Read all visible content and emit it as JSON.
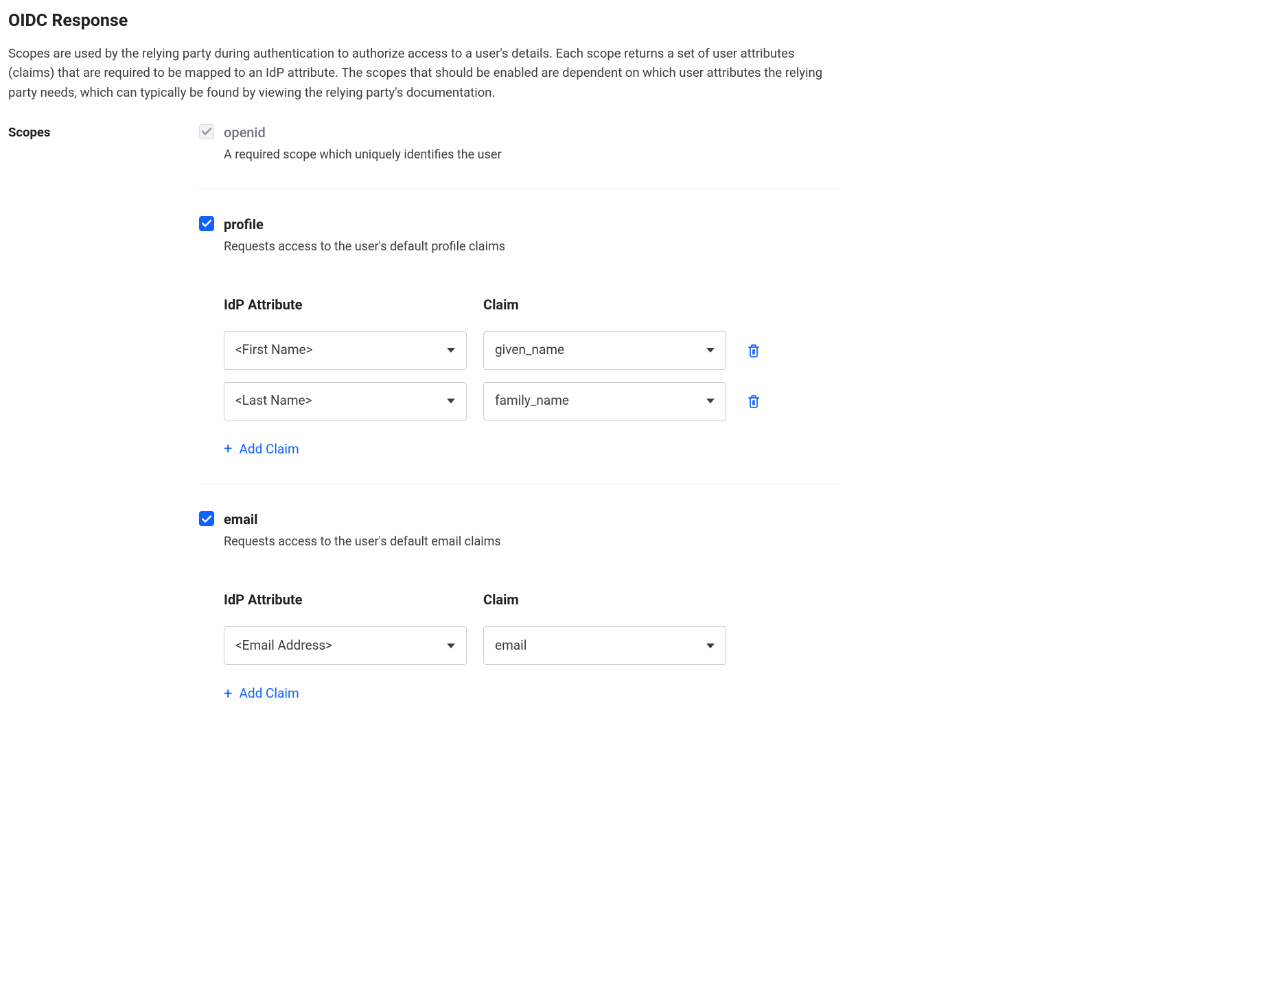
{
  "header": {
    "title": "OIDC Response",
    "intro": "Scopes are used by the relying party during authentication to authorize access to a user's details. Each scope returns a set of user attributes (claims) that are required to be mapped to an IdP attribute. The scopes that should be enabled are dependent on which user attributes the relying party needs, which can typically be found by viewing the relying party's documentation."
  },
  "labels": {
    "scopes": "Scopes",
    "idp_attribute": "IdP Attribute",
    "claim": "Claim",
    "add_claim": "Add Claim"
  },
  "scopes": {
    "openid": {
      "name": "openid",
      "desc": "A required scope which uniquely identifies the user",
      "checked": true,
      "disabled": true
    },
    "profile": {
      "name": "profile",
      "desc": "Requests access to the user's default profile claims",
      "checked": true,
      "disabled": false,
      "claims": [
        {
          "idp": "<First Name>",
          "claim": "given_name",
          "deletable": true
        },
        {
          "idp": "<Last Name>",
          "claim": "family_name",
          "deletable": true
        }
      ]
    },
    "email": {
      "name": "email",
      "desc": "Requests access to the user's default email claims",
      "checked": true,
      "disabled": false,
      "claims": [
        {
          "idp": "<Email Address>",
          "claim": "email",
          "deletable": false
        }
      ]
    }
  }
}
